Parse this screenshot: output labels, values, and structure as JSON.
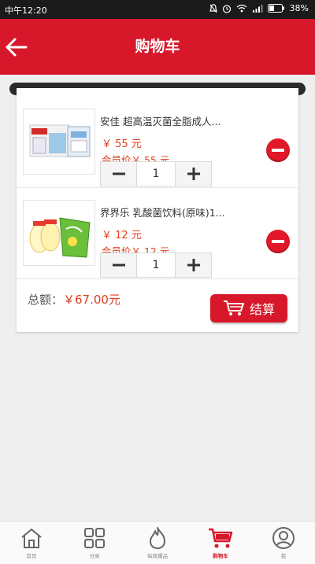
{
  "status_bar": {
    "time": "中午12:20",
    "battery": "38%"
  },
  "header": {
    "title": "购物车"
  },
  "cart": {
    "items": [
      {
        "name": "安佳 超高温灭菌全脂成人...",
        "price": "￥ 55 元",
        "member_price": "会员价￥ 55 元",
        "quantity": "1"
      },
      {
        "name": "界界乐 乳酸菌饮料(原味)1...",
        "price": "￥ 12 元",
        "member_price": "会员价￥ 12 元",
        "quantity": "1"
      }
    ],
    "total_label": "总额：",
    "total_amount": "￥67.00元",
    "checkout_label": "结算"
  },
  "tabs": [
    {
      "label": "首页",
      "icon": "home-icon"
    },
    {
      "label": "分类",
      "icon": "grid-icon"
    },
    {
      "label": "每周爆品",
      "icon": "hot-icon"
    },
    {
      "label": "购物车",
      "icon": "cart-icon",
      "active": true
    },
    {
      "label": "我",
      "icon": "user-icon"
    }
  ],
  "colors": {
    "brand": "#d7182a",
    "price": "#e03e1e"
  }
}
